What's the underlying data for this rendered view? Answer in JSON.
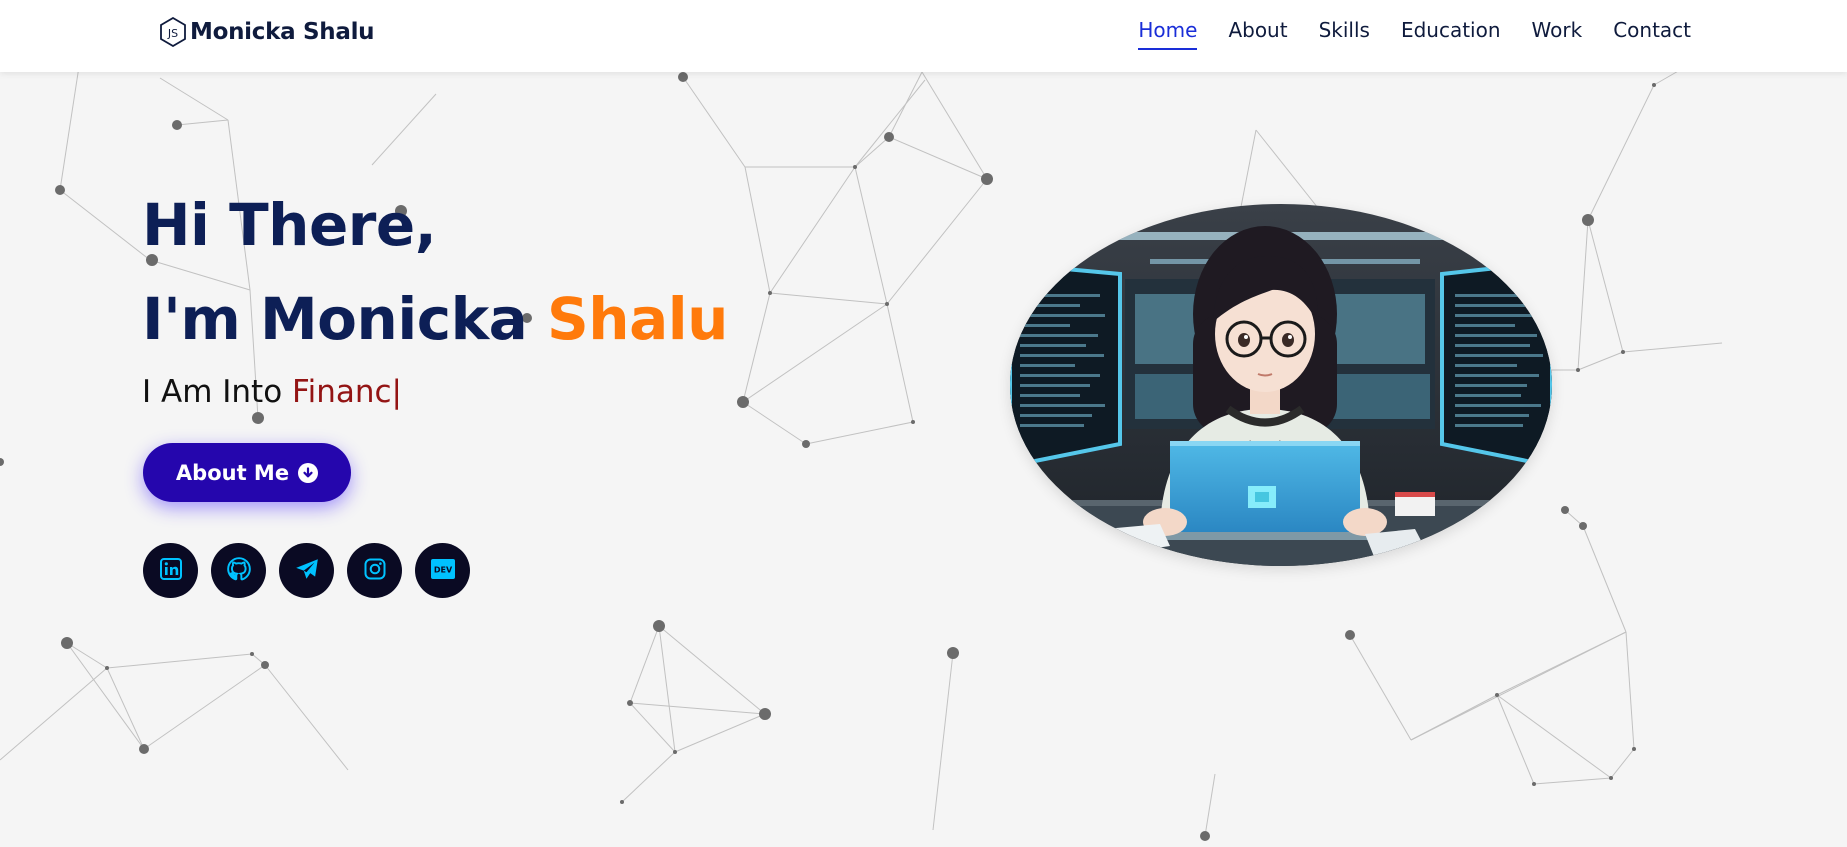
{
  "brand": {
    "name": "Monicka Shalu",
    "icon": "nodejs-logo-icon"
  },
  "nav": {
    "items": [
      {
        "label": "Home",
        "active": true
      },
      {
        "label": "About",
        "active": false
      },
      {
        "label": "Skills",
        "active": false
      },
      {
        "label": "Education",
        "active": false
      },
      {
        "label": "Work",
        "active": false
      },
      {
        "label": "Contact",
        "active": false
      }
    ]
  },
  "hero": {
    "greeting": "Hi There,",
    "intro_prefix": "I'm Monicka",
    "intro_accent": "Shalu",
    "typing_prefix": "I Am Into",
    "typing_text": "Financ|",
    "about_button_label": "About Me",
    "about_button_icon": "arrow-down-circle-icon",
    "image": "girl-coding-laptop-illustration"
  },
  "socials": [
    {
      "name": "linkedin",
      "icon": "linkedin-icon"
    },
    {
      "name": "github",
      "icon": "github-icon"
    },
    {
      "name": "telegram",
      "icon": "telegram-icon"
    },
    {
      "name": "instagram",
      "icon": "instagram-icon"
    },
    {
      "name": "dev",
      "icon": "dev-icon",
      "icon_text": "DEV"
    }
  ],
  "colors": {
    "navy": "#0d1f56",
    "accent_orange": "#ff7a0b",
    "typed_red": "#931414",
    "button_bg": "#2506ad",
    "nav_active": "#1a2ed8",
    "social_bg": "#0a0a23",
    "social_icon": "#00c2ff",
    "background": "#f5f5f5"
  }
}
